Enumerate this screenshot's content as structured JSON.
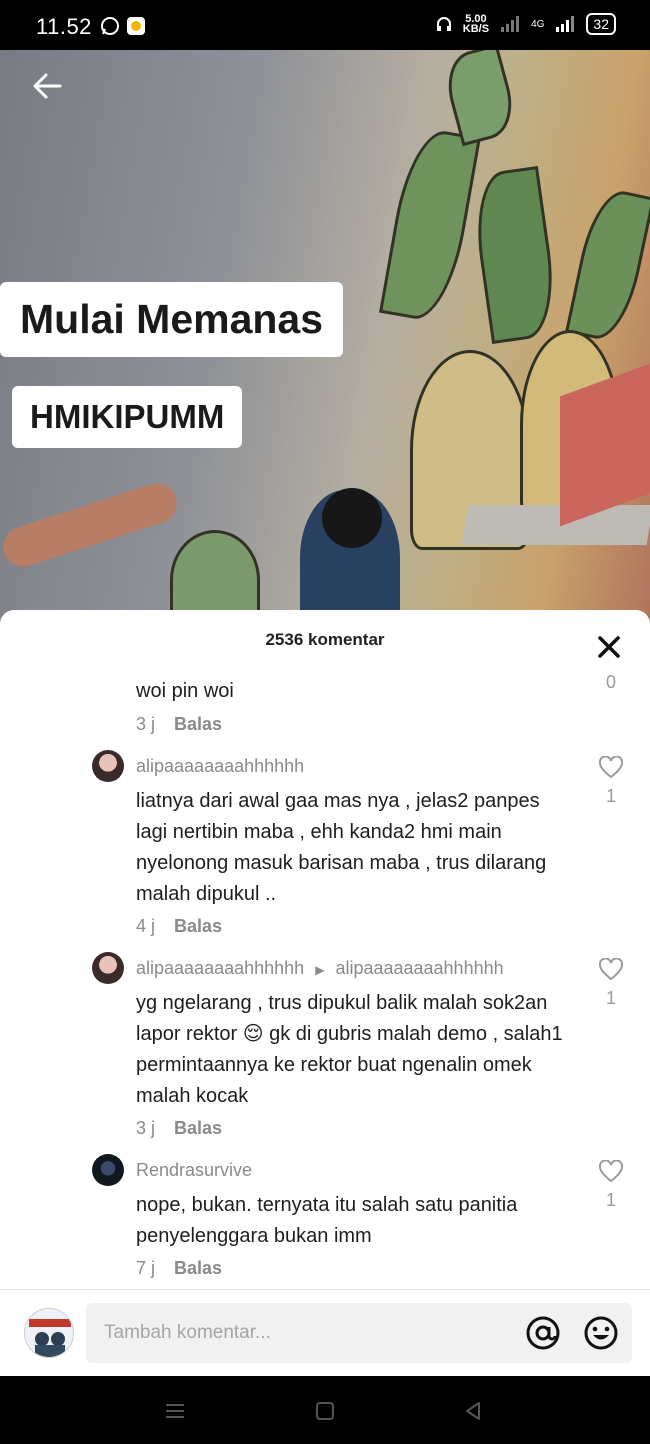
{
  "status_bar": {
    "time": "11.52",
    "speed_value": "5.00",
    "speed_unit": "KB/S",
    "network": "4G",
    "battery": "32"
  },
  "video": {
    "caption_1": "Mulai Memanas",
    "caption_2": "HMIKIPUMM"
  },
  "comments_panel": {
    "header": "2536 komentar",
    "comments": [
      {
        "username": "",
        "text": "woi pin woi",
        "time": "3 j",
        "reply_label": "Balas",
        "likes": "0",
        "liked_icon": "none"
      },
      {
        "username": "alipaaaaaaaahhhhhh",
        "text": "liatnya dari awal gaa mas nya , jelas2 panpes lagi nertibin maba , ehh kanda2 hmi main nyelonong masuk barisan maba , trus dilarang malah dipukul ..",
        "time": "4 j",
        "reply_label": "Balas",
        "likes": "1"
      },
      {
        "username": "alipaaaaaaaahhhhhh",
        "reply_to": "alipaaaaaaaahhhhhh",
        "text": "yg ngelarang , trus dipukul balik malah sok2an lapor rektor 😌 gk di gubris malah demo , salah1 permintaannya ke rektor buat ngenalin omek malah kocak",
        "time": "3 j",
        "reply_label": "Balas",
        "likes": "1"
      },
      {
        "username": "Rendrasurvive",
        "text": "nope, bukan. ternyata itu salah satu panitia penyelenggara bukan imm",
        "time": "7 j",
        "reply_label": "Balas",
        "likes": "1"
      }
    ]
  },
  "composer": {
    "placeholder": "Tambah komentar..."
  },
  "colors": {
    "sheet_bg": "#ffffff",
    "meta_gray": "#8a8a8a",
    "input_bg": "#f1f1f2"
  }
}
